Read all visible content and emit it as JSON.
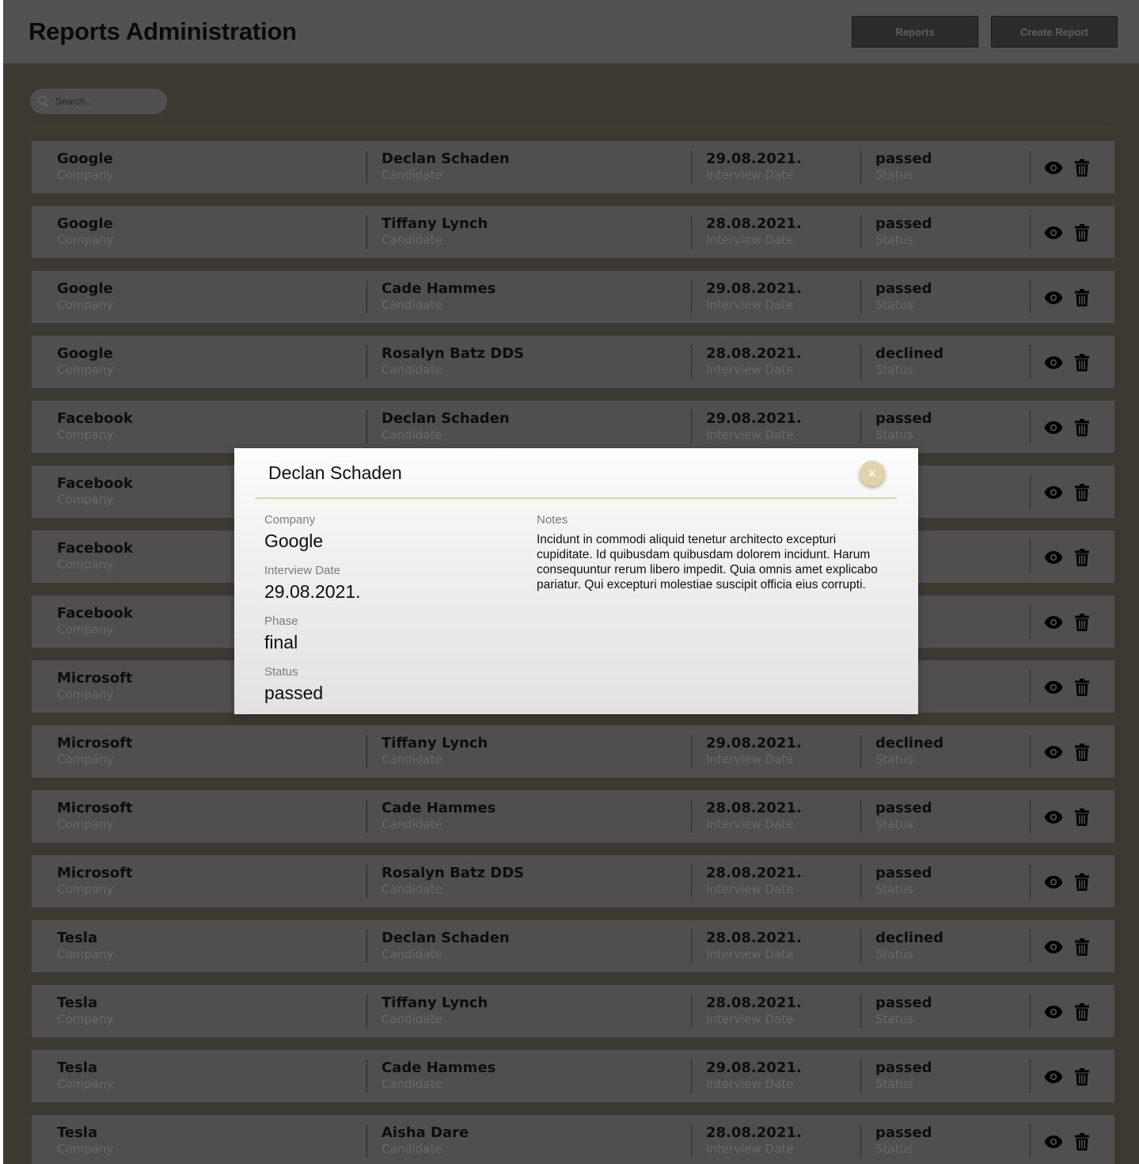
{
  "header": {
    "title": "Reports Administration",
    "reports_label": "Reports",
    "create_label": "Create Report"
  },
  "search": {
    "placeholder": "Search..."
  },
  "labels": {
    "company": "Company",
    "candidate": "Candidate",
    "date": "Interview Date",
    "status": "Status"
  },
  "reports": [
    {
      "company": "Google",
      "candidate": "Declan Schaden",
      "date": "29.08.2021.",
      "status": "passed"
    },
    {
      "company": "Google",
      "candidate": "Tiffany Lynch",
      "date": "28.08.2021.",
      "status": "passed"
    },
    {
      "company": "Google",
      "candidate": "Cade Hammes",
      "date": "29.08.2021.",
      "status": "passed"
    },
    {
      "company": "Google",
      "candidate": "Rosalyn Batz DDS",
      "date": "28.08.2021.",
      "status": "declined"
    },
    {
      "company": "Facebook",
      "candidate": "Declan Schaden",
      "date": "29.08.2021.",
      "status": "passed"
    },
    {
      "company": "Facebook",
      "candidate": "",
      "date": "",
      "status": "d"
    },
    {
      "company": "Facebook",
      "candidate": "",
      "date": "",
      "status": "ed"
    },
    {
      "company": "Facebook",
      "candidate": "",
      "date": "",
      "status": "ed"
    },
    {
      "company": "Microsoft",
      "candidate": "",
      "date": "",
      "status": "ed"
    },
    {
      "company": "Microsoft",
      "candidate": "Tiffany Lynch",
      "date": "29.08.2021.",
      "status": "declined"
    },
    {
      "company": "Microsoft",
      "candidate": "Cade Hammes",
      "date": "28.08.2021.",
      "status": "passed"
    },
    {
      "company": "Microsoft",
      "candidate": "Rosalyn Batz DDS",
      "date": "28.08.2021.",
      "status": "passed"
    },
    {
      "company": "Tesla",
      "candidate": "Declan Schaden",
      "date": "28.08.2021.",
      "status": "declined"
    },
    {
      "company": "Tesla",
      "candidate": "Tiffany Lynch",
      "date": "28.08.2021.",
      "status": "passed"
    },
    {
      "company": "Tesla",
      "candidate": "Cade Hammes",
      "date": "29.08.2021.",
      "status": "passed"
    },
    {
      "company": "Tesla",
      "candidate": "Aisha Dare",
      "date": "28.08.2021.",
      "status": "passed"
    }
  ],
  "modal": {
    "title": "Declan Schaden",
    "close_label": "×",
    "company_label": "Company",
    "company": "Google",
    "date_label": "Interview Date",
    "date": "29.08.2021.",
    "phase_label": "Phase",
    "phase": "final",
    "status_label": "Status",
    "status": "passed",
    "notes_label": "Notes",
    "notes": "Incidunt in commodi aliquid tenetur architecto excepturi cupiditate. Id quibusdam quibusdam dolorem incidunt. Harum consequuntur rerum libero impedit. Quia omnis amet explicabo pariatur. Qui excepturi molestiae suscipit officia eius corrupti."
  },
  "icons": {
    "view": "eye-icon",
    "delete": "trash-icon"
  },
  "colors": {
    "accent": "#e3d4a8",
    "overlay": "#3c3a30"
  }
}
